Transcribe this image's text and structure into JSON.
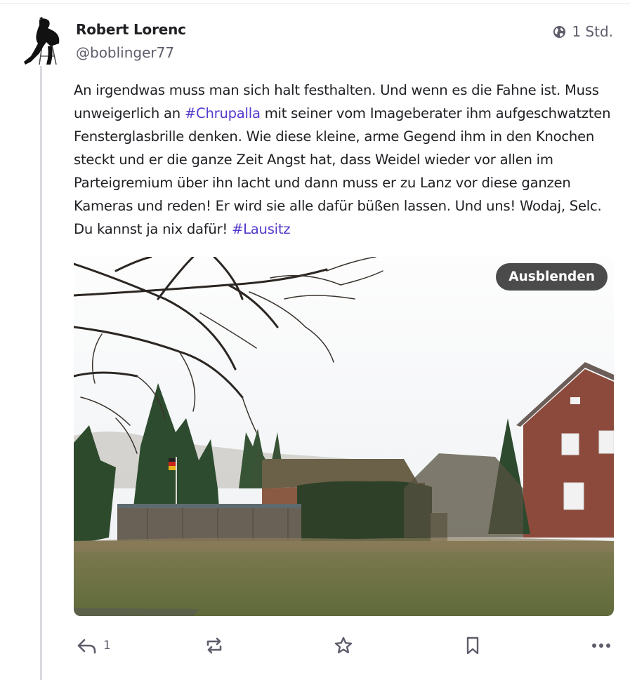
{
  "post": {
    "author_name": "Robert Lorenc",
    "author_handle": "@boblinger77",
    "visibility_icon": "globe-icon",
    "timestamp": "1 Std.",
    "text_segments": [
      "An irgendwas muss man sich halt festhalten. Und wenn es die Fahne ist. Muss unweigerlich an ",
      " mit seiner vom Imageberater ihm aufgeschwatzten Fensterglasbrille denken. Wie diese kleine, arme Gegend ihm in den Knochen steckt und er die ganze Zeit Angst hat, dass Weidel wieder vor allen im Parteigremium über ihn lacht und dann muss er zu Lanz vor diese ganzen Kameras und reden! Er wird sie alle dafür büßen lassen. Und uns! Wodaj, Selc. Du kannst ja nix dafür! "
    ],
    "hashtags": [
      "#Chrupalla",
      "#Lausitz"
    ],
    "media": {
      "hide_label": "Ausblenden"
    },
    "actions": {
      "reply_icon": "reply-icon",
      "reply_count": "1",
      "boost_icon": "boost-icon",
      "favourite_icon": "star-icon",
      "bookmark_icon": "bookmark-icon",
      "more_icon": "more-icon"
    }
  },
  "colors": {
    "hashtag": "#563acc",
    "muted": "#5d5d6b",
    "hide_button_bg": "#4b4b4b"
  }
}
